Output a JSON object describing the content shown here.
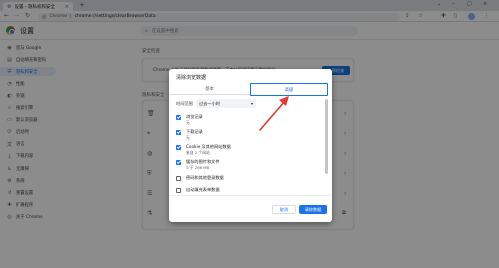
{
  "browser": {
    "tab_title": "设置 - 隐私权和安全",
    "omnibox_scheme": "Chrome",
    "omnibox_url": "chrome://settings/clearBrowserData",
    "new_tab_glyph": "+",
    "tab_close_glyph": "×"
  },
  "header": {
    "title": "设置",
    "search_placeholder": "在设置中搜索"
  },
  "sidebar": {
    "items": [
      {
        "label": "您与 Google",
        "icon": "person-icon",
        "glyph": "◉"
      },
      {
        "label": "自动填充和密码",
        "icon": "autofill-icon",
        "glyph": "▤"
      },
      {
        "label": "隐私和安全",
        "icon": "shield-icon",
        "glyph": "⛨",
        "active": true
      },
      {
        "label": "性能",
        "icon": "speed-icon",
        "glyph": "◔"
      },
      {
        "label": "外观",
        "icon": "palette-icon",
        "glyph": "◐"
      },
      {
        "label": "搜索引擎",
        "icon": "search-icon",
        "glyph": "⌕"
      },
      {
        "label": "默认浏览器",
        "icon": "browser-icon",
        "glyph": "▭"
      },
      {
        "label": "启动时",
        "icon": "power-icon",
        "glyph": "⏻"
      },
      {
        "label": "语言",
        "icon": "language-icon",
        "glyph": "文"
      },
      {
        "label": "下载内容",
        "icon": "download-icon",
        "glyph": "⤓"
      },
      {
        "label": "无障碍",
        "icon": "accessibility-icon",
        "glyph": "♿"
      },
      {
        "label": "系统",
        "icon": "wrench-icon",
        "glyph": "⚙"
      },
      {
        "label": "重置设置",
        "icon": "reset-icon",
        "glyph": "↺"
      },
      {
        "label": "扩展程序",
        "icon": "puzzle-icon",
        "glyph": "✚"
      },
      {
        "label": "关于 Chrome",
        "icon": "chrome-icon",
        "glyph": "◎"
      }
    ]
  },
  "main": {
    "safety_title": "安全检查",
    "safety_text": "Chrome 有助于保护您免受数据泄露、不良扩展程序等问题的影响",
    "safety_button": "立即检查",
    "privacy_title": "隐私和安全"
  },
  "dialog": {
    "title": "清除浏览数据",
    "tab_basic": "基本",
    "tab_advanced": "高级",
    "range_label": "时间范围",
    "range_value": "过去一小时",
    "options": [
      {
        "label": "浏览记录",
        "sub": "无",
        "checked": true
      },
      {
        "label": "下载记录",
        "sub": "无",
        "checked": true
      },
      {
        "label": "Cookie 及其他网站数据",
        "sub": "来自 2 个网站",
        "checked": true
      },
      {
        "label": "缓存的图片和文件",
        "sub": "少于 266 MB",
        "checked": true
      },
      {
        "label": "密码和其他登录数据",
        "sub": "",
        "checked": false
      },
      {
        "label": "自动填充表单数据",
        "sub": "",
        "checked": false
      }
    ],
    "cancel_label": "取消",
    "clear_label": "清除数据"
  },
  "colors": {
    "accent": "#1a73e8",
    "arrow": "#e53935"
  }
}
